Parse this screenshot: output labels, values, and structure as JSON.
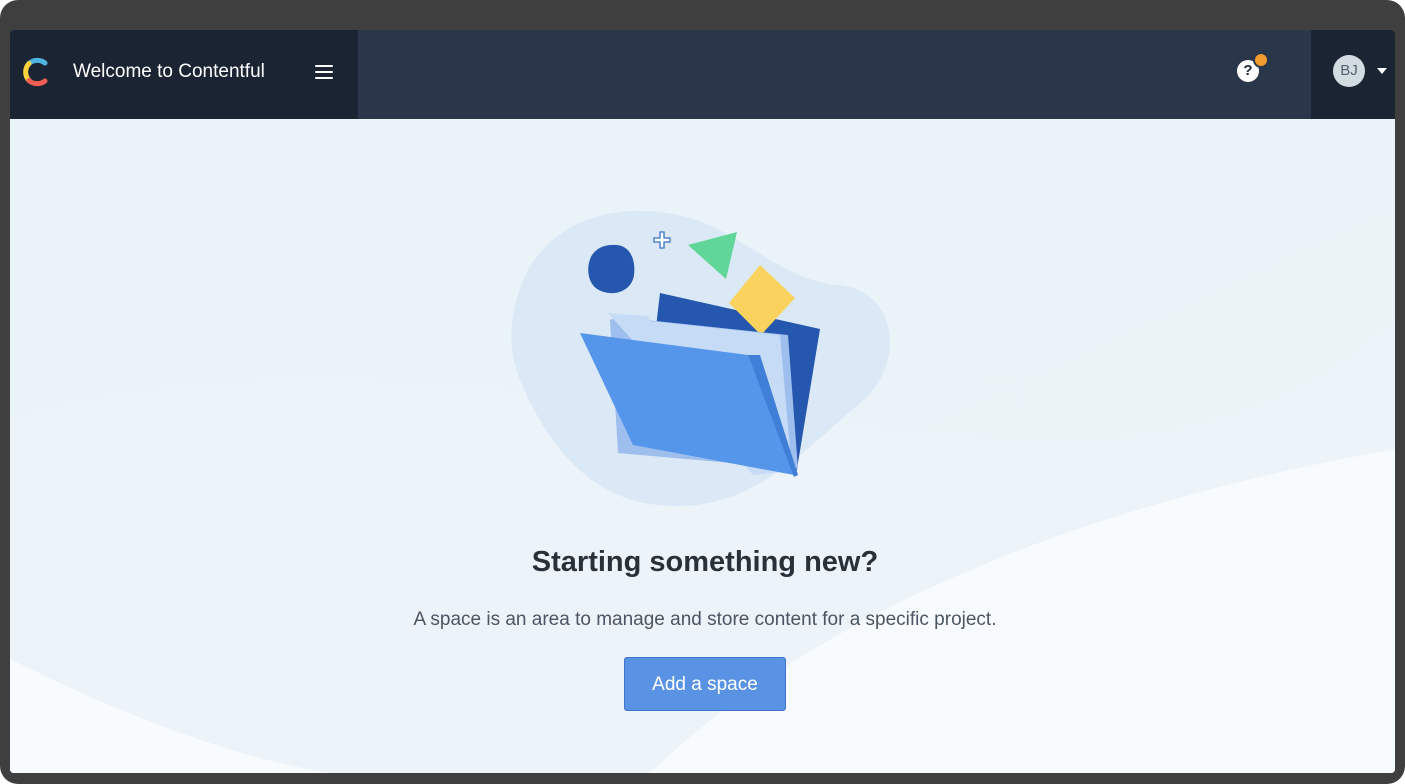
{
  "header": {
    "title": "Welcome to Contentful",
    "menu_icon": "hamburger-menu-icon",
    "help_icon": "question-circle-icon",
    "notification_color": "#f29b2e",
    "user_initials": "BJ",
    "account_icon": "chevron-down-icon"
  },
  "main": {
    "illustration": "folder-illustration",
    "heading": "Starting something new?",
    "description": "A space is an area to manage and store content for a specific project.",
    "add_space_label": "Add a space"
  },
  "colors": {
    "brand_bg": "#1b2433",
    "topbar_bg": "#2a3649",
    "primary_button": "#5a93e3",
    "heading_text": "#2a3039"
  }
}
